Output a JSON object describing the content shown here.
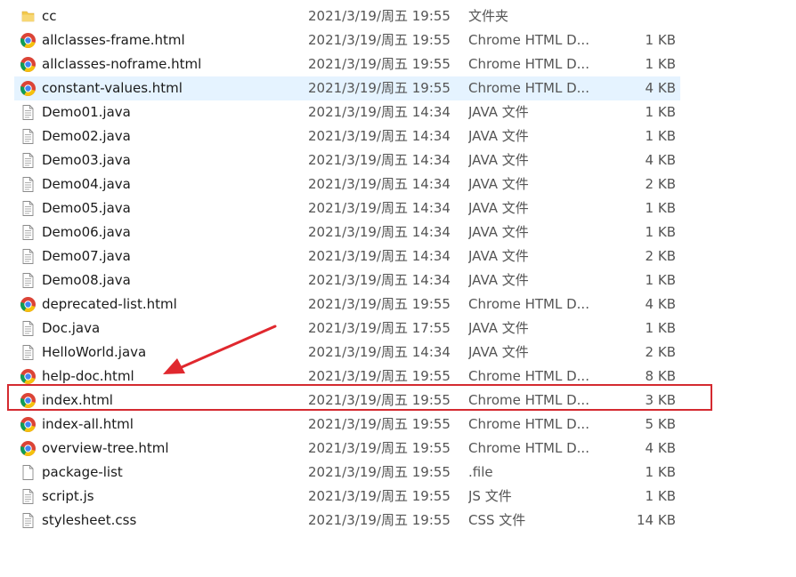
{
  "files": [
    {
      "name": "cc",
      "date": "2021/3/19/周五 19:55",
      "type": "文件夹",
      "size": "",
      "icon": "folder-icon",
      "selected": false
    },
    {
      "name": "allclasses-frame.html",
      "date": "2021/3/19/周五 19:55",
      "type": "Chrome HTML D...",
      "size": "1 KB",
      "icon": "chrome-icon",
      "selected": false
    },
    {
      "name": "allclasses-noframe.html",
      "date": "2021/3/19/周五 19:55",
      "type": "Chrome HTML D...",
      "size": "1 KB",
      "icon": "chrome-icon",
      "selected": false
    },
    {
      "name": "constant-values.html",
      "date": "2021/3/19/周五 19:55",
      "type": "Chrome HTML D...",
      "size": "4 KB",
      "icon": "chrome-icon",
      "selected": true
    },
    {
      "name": "Demo01.java",
      "date": "2021/3/19/周五 14:34",
      "type": "JAVA 文件",
      "size": "1 KB",
      "icon": "text-file-icon",
      "selected": false
    },
    {
      "name": "Demo02.java",
      "date": "2021/3/19/周五 14:34",
      "type": "JAVA 文件",
      "size": "1 KB",
      "icon": "text-file-icon",
      "selected": false
    },
    {
      "name": "Demo03.java",
      "date": "2021/3/19/周五 14:34",
      "type": "JAVA 文件",
      "size": "4 KB",
      "icon": "text-file-icon",
      "selected": false
    },
    {
      "name": "Demo04.java",
      "date": "2021/3/19/周五 14:34",
      "type": "JAVA 文件",
      "size": "2 KB",
      "icon": "text-file-icon",
      "selected": false
    },
    {
      "name": "Demo05.java",
      "date": "2021/3/19/周五 14:34",
      "type": "JAVA 文件",
      "size": "1 KB",
      "icon": "text-file-icon",
      "selected": false
    },
    {
      "name": "Demo06.java",
      "date": "2021/3/19/周五 14:34",
      "type": "JAVA 文件",
      "size": "1 KB",
      "icon": "text-file-icon",
      "selected": false
    },
    {
      "name": "Demo07.java",
      "date": "2021/3/19/周五 14:34",
      "type": "JAVA 文件",
      "size": "2 KB",
      "icon": "text-file-icon",
      "selected": false
    },
    {
      "name": "Demo08.java",
      "date": "2021/3/19/周五 14:34",
      "type": "JAVA 文件",
      "size": "1 KB",
      "icon": "text-file-icon",
      "selected": false
    },
    {
      "name": "deprecated-list.html",
      "date": "2021/3/19/周五 19:55",
      "type": "Chrome HTML D...",
      "size": "4 KB",
      "icon": "chrome-icon",
      "selected": false
    },
    {
      "name": "Doc.java",
      "date": "2021/3/19/周五 17:55",
      "type": "JAVA 文件",
      "size": "1 KB",
      "icon": "text-file-icon",
      "selected": false
    },
    {
      "name": "HelloWorld.java",
      "date": "2021/3/19/周五 14:34",
      "type": "JAVA 文件",
      "size": "2 KB",
      "icon": "text-file-icon",
      "selected": false
    },
    {
      "name": "help-doc.html",
      "date": "2021/3/19/周五 19:55",
      "type": "Chrome HTML D...",
      "size": "8 KB",
      "icon": "chrome-icon",
      "selected": false
    },
    {
      "name": "index.html",
      "date": "2021/3/19/周五 19:55",
      "type": "Chrome HTML D...",
      "size": "3 KB",
      "icon": "chrome-icon",
      "selected": false
    },
    {
      "name": "index-all.html",
      "date": "2021/3/19/周五 19:55",
      "type": "Chrome HTML D...",
      "size": "5 KB",
      "icon": "chrome-icon",
      "selected": false
    },
    {
      "name": "overview-tree.html",
      "date": "2021/3/19/周五 19:55",
      "type": "Chrome HTML D...",
      "size": "4 KB",
      "icon": "chrome-icon",
      "selected": false
    },
    {
      "name": "package-list",
      "date": "2021/3/19/周五 19:55",
      "type": ".file",
      "size": "1 KB",
      "icon": "blank-file-icon",
      "selected": false
    },
    {
      "name": "script.js",
      "date": "2021/3/19/周五 19:55",
      "type": "JS 文件",
      "size": "1 KB",
      "icon": "text-file-icon",
      "selected": false
    },
    {
      "name": "stylesheet.css",
      "date": "2021/3/19/周五 19:55",
      "type": "CSS 文件",
      "size": "14 KB",
      "icon": "text-file-icon",
      "selected": false
    }
  ],
  "annotation": {
    "highlighted_file": "index.html",
    "box_color": "#d42a30",
    "arrow_color": "#e0282e"
  },
  "colors": {
    "selected_row_bg": "#e5f3ff",
    "folder": "#f2c94c",
    "chrome_red": "#db4437",
    "chrome_yellow": "#f4c20d",
    "chrome_green": "#0f9d58",
    "chrome_blue": "#4285f4"
  }
}
